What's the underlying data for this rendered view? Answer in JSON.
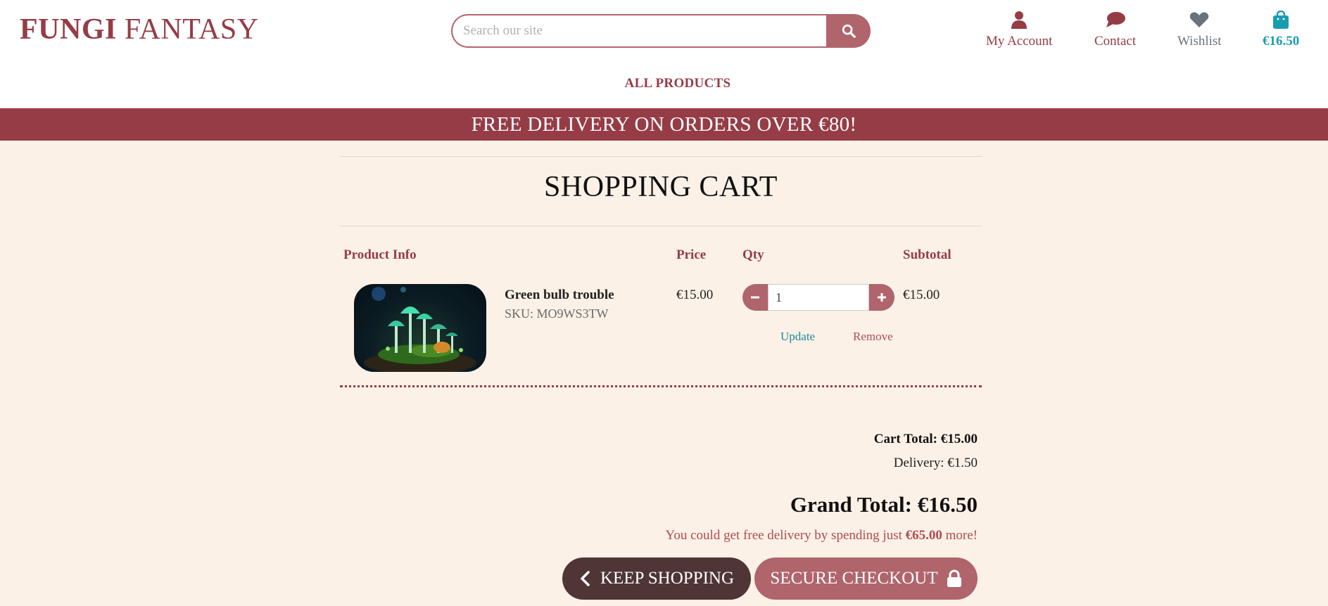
{
  "brand": {
    "logo_bold": "FUNGI",
    "logo_light": "FANTASY"
  },
  "search": {
    "placeholder": "Search our site"
  },
  "nav": {
    "account": "My Account",
    "contact": "Contact",
    "wishlist": "Wishlist",
    "bag_total": "€16.50",
    "all_products": "ALL PRODUCTS"
  },
  "banner": "FREE DELIVERY ON ORDERS OVER €80!",
  "cart": {
    "title": "SHOPPING CART",
    "headers": {
      "product": "Product Info",
      "price": "Price",
      "qty": "Qty",
      "subtotal": "Subtotal"
    },
    "items": [
      {
        "name": "Green bulb trouble",
        "sku": "SKU: MO9WS3TW",
        "price": "€15.00",
        "qty": "1",
        "subtotal": "€15.00",
        "update_label": "Update",
        "remove_label": "Remove"
      }
    ],
    "cart_total": "Cart Total: €15.00",
    "delivery": "Delivery: €1.50",
    "grand_total": "Grand Total: €16.50",
    "free_msg": {
      "prefix": "You could get free delivery by spending just ",
      "amount": "€65.00",
      "suffix": " more!"
    },
    "keep_shopping": "KEEP SHOPPING",
    "secure_checkout": "SECURE CHECKOUT"
  },
  "colors": {
    "brand": "#963c46",
    "accent": "#b0646c",
    "link": "#1a9cb0",
    "background": "#fcf1e6"
  }
}
